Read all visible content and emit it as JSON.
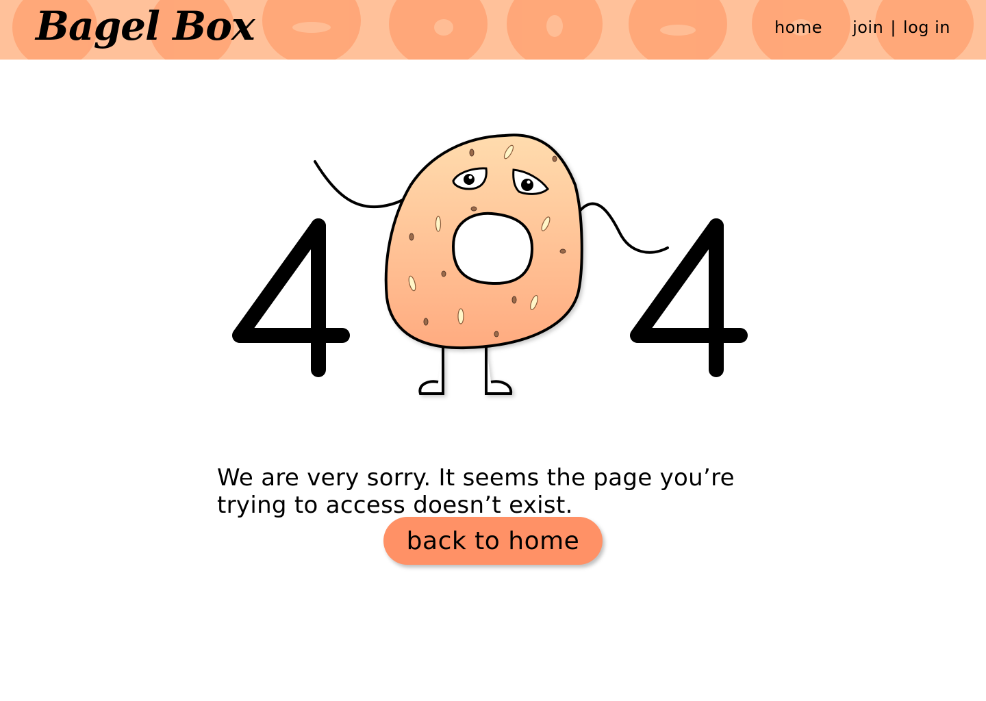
{
  "header": {
    "logo": "Bagel Box",
    "nav": {
      "home_label": "home",
      "join_label": "join",
      "separator": "|",
      "login_label": "log in"
    },
    "background_color": "#ffc19a",
    "bagel_color": "#ff9f6e"
  },
  "illustration": {
    "left_digit": "4",
    "right_digit": "4",
    "mascot": "sad-bagel-icon",
    "bagel_fill_top": "#ffdcae",
    "bagel_fill_bottom": "#ffab80"
  },
  "main": {
    "message": "We are very sorry. It seems the page you’re trying to access doesn’t exist.",
    "back_button_label": "back to home",
    "button_color": "#ff9166"
  }
}
